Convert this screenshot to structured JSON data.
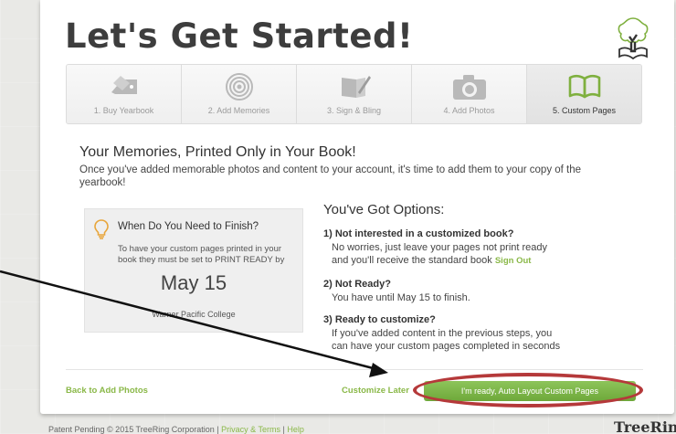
{
  "header": {
    "title": "Let's Get Started!",
    "logo_icon": "treering-tree-book-icon"
  },
  "steps": [
    {
      "label": "1. Buy Yearbook",
      "icon": "yearbook-tag-icon"
    },
    {
      "label": "2. Add Memories",
      "icon": "tree-rings-icon"
    },
    {
      "label": "3. Sign & Bling",
      "icon": "sign-pencil-icon"
    },
    {
      "label": "4. Add Photos",
      "icon": "camera-icon"
    },
    {
      "label": "5. Custom Pages",
      "icon": "open-book-icon",
      "active": true
    }
  ],
  "intro": {
    "heading": "Your Memories, Printed Only in Your Book!",
    "text": "Once you've added memorable photos and content to your account, it's time to add them to your copy of the yearbook!"
  },
  "deadline": {
    "title": "When Do You Need to Finish?",
    "text": "To have your custom pages printed in your book they must be set to PRINT READY by",
    "date": "May 15",
    "school": "Warner Pacific College",
    "icon": "lightbulb-icon"
  },
  "options": {
    "title": "You've Got Options:",
    "items": [
      {
        "question": "1) Not interested in a customized book?",
        "line1": "No worries, just leave your pages not print ready",
        "line2": "and you'll receive the standard book",
        "link": "Sign Out"
      },
      {
        "question": "2) Not Ready?",
        "line1": "You have until May 15 to finish."
      },
      {
        "question": "3) Ready to customize?",
        "line1": "If you've added content in the previous steps, you",
        "line2": "can have your custom pages completed in seconds"
      }
    ]
  },
  "actions": {
    "back": "Back to Add Photos",
    "customize_later": "Customize Later",
    "ready": "I'm ready, Auto Layout Custom Pages"
  },
  "footer": {
    "text": "Patent Pending © 2015 TreeRing Corporation |",
    "privacy": "Privacy & Terms",
    "sep": "|",
    "help": "Help",
    "brand": "TreeRing"
  },
  "colors": {
    "accent_green": "#8ab848",
    "annotation_red": "#b5393a"
  }
}
